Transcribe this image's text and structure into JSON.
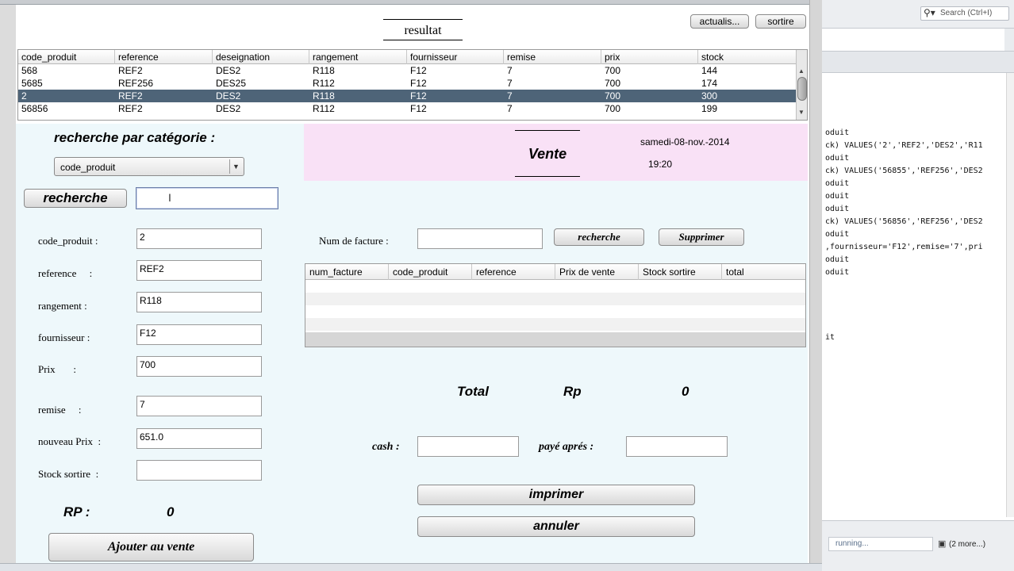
{
  "results": {
    "title": "resultat",
    "refresh_label": "actualis...",
    "exit_label": "sortire",
    "columns": [
      "code_produit",
      "reference",
      "deseignation",
      "rangement",
      "fournisseur",
      "remise",
      "prix",
      "stock"
    ],
    "rows": [
      [
        "568",
        "REF2",
        "DES2",
        "R118",
        "F12",
        "7",
        "700",
        "144"
      ],
      [
        "5685",
        "REF256",
        "DES25",
        "R112",
        "F12",
        "7",
        "700",
        "174"
      ],
      [
        "2",
        "REF2",
        "DES2",
        "R118",
        "F12",
        "7",
        "700",
        "300"
      ],
      [
        "56856",
        "REF2",
        "DES2",
        "R112",
        "F12",
        "7",
        "700",
        "199"
      ]
    ],
    "selected_row": 2
  },
  "search": {
    "heading": "recherche par catégorie :",
    "category_selected": "code_produit",
    "button_label": "recherche",
    "input_value": ""
  },
  "form": {
    "code_produit_label": "code_produit :",
    "code_produit_value": "2",
    "reference_label": "reference     :",
    "reference_value": "REF2",
    "rangement_label": "rangement :",
    "rangement_value": "R118",
    "fournisseur_label": "fournisseur :",
    "fournisseur_value": "F12",
    "prix_label": "Prix       :",
    "prix_value": "700",
    "remise_label": "remise     :",
    "remise_value": "7",
    "nouveau_prix_label": "nouveau Prix  :",
    "nouveau_prix_value": "651.0",
    "stock_sortire_label": "Stock sortire  :",
    "stock_sortire_value": "",
    "rp_label": "RP :",
    "rp_value": "0",
    "add_button_label": "Ajouter au vente"
  },
  "vente": {
    "title": "Vente",
    "date": "samedi-08-nov.-2014",
    "time": "19:20",
    "facture_label": "Num de facture :",
    "facture_value": "",
    "search_label": "recherche",
    "delete_label": "Supprimer",
    "columns": [
      "num_facture",
      "code_produit",
      "reference",
      "Prix de vente",
      "Stock sortire",
      "total"
    ],
    "total_label": "Total",
    "currency_label": "Rp",
    "total_value": "0",
    "cash_label": "cash :",
    "cash_value": "",
    "paye_label": "payé aprés :",
    "paye_value": "",
    "print_label": "imprimer",
    "cancel_label": "annuler"
  },
  "ide": {
    "search_placeholder": "Search (Ctrl+I)",
    "code_lines": [
      "oduit",
      "ck) VALUES('2','REF2','DES2','R11",
      "oduit",
      "ck) VALUES('56855','REF256','DES2",
      "oduit",
      "oduit",
      "oduit",
      "ck) VALUES('56856','REF256','DES2",
      "oduit",
      ",fournisseur='F12',remise='7',pri",
      "oduit",
      "oduit"
    ],
    "trailing_line": "it",
    "status_running": "running...",
    "status_more": "(2 more...)"
  }
}
